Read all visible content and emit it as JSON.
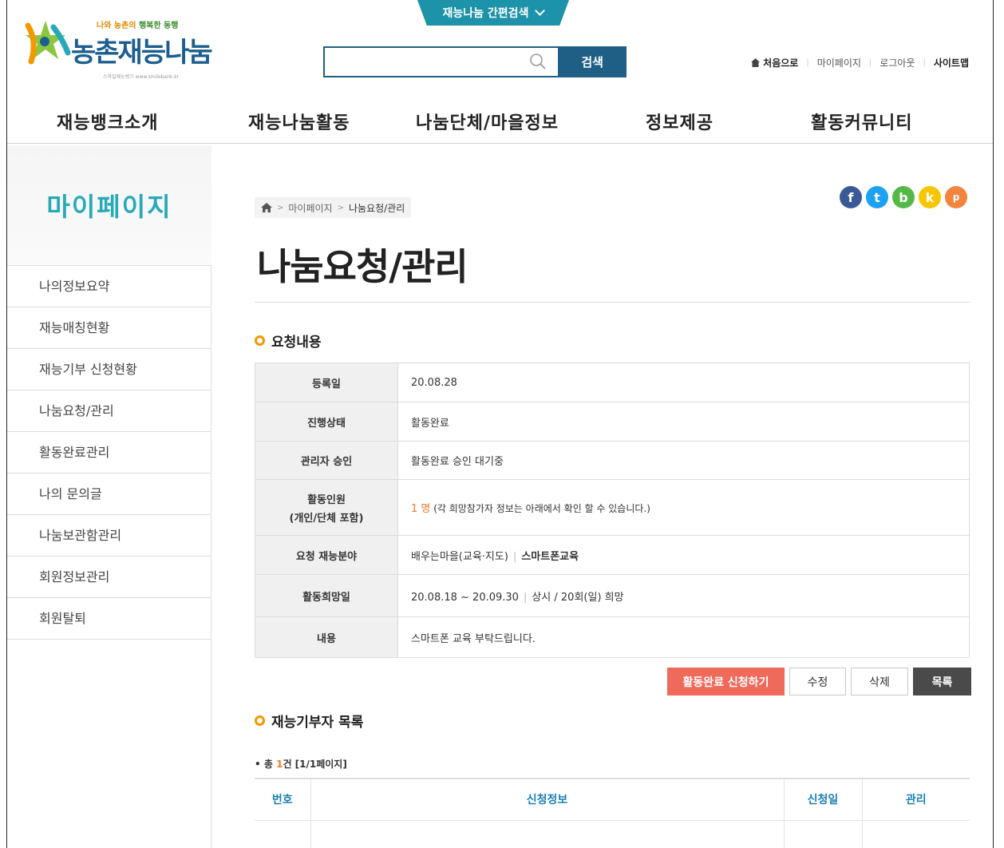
{
  "header": {
    "quick_search_tab": "재능나눔 간편검색",
    "logo": {
      "slogan_pre": "나와 농촌의",
      "slogan_mid": " 행복한 동행",
      "name": "농촌재능나눔",
      "site": "스마일재능뱅크  www.smilebank.kr"
    },
    "search": {
      "placeholder": "",
      "button": "검색"
    },
    "util": {
      "home": "처음으로",
      "mypage": "마이페이지",
      "logout": "로그아웃",
      "sitemap": "사이트맵"
    },
    "gnb": [
      "재능뱅크소개",
      "재능나눔활동",
      "나눔단체/마을정보",
      "정보제공",
      "활동커뮤니티"
    ]
  },
  "sidebar": {
    "title": "마이페이지",
    "items": [
      "나의정보요약",
      "재능매칭현황",
      "재능기부 신청현황",
      "나눔요청/관리",
      "활동완료관리",
      "나의 문의글",
      "나눔보관함관리",
      "회원정보관리",
      "회원탈퇴"
    ]
  },
  "breadcrumb": {
    "sep": ">",
    "level1": "마이페이지",
    "current": "나눔요청/관리"
  },
  "sns": [
    "f",
    "t",
    "b",
    "k",
    "p"
  ],
  "page_title": "나눔요청/관리",
  "request": {
    "section_title": "요청내용",
    "rows": {
      "reg_label": "등록일",
      "reg_value": "20.08.28",
      "status_label": "진행상태",
      "status_value": "활동완료",
      "admin_label": "관리자 승인",
      "admin_value": "활동완료 승인 대기중",
      "members_label_1": "활동인원",
      "members_label_2": "(개인/단체 포함)",
      "members_count": "1 명",
      "members_note": " (각 희망참가자 정보는 아래에서 확인 할 수 있습니다.)",
      "field_label": "요청 재능분야",
      "field_value": "배우는마을(교육·지도)",
      "field_sub": "스마트폰교육",
      "date_label": "활동희망일",
      "date_value": "20.08.18 ~ 20.09.30",
      "date_note": "상시 / 20회(일) 희망",
      "content_label": "내용",
      "content_value": "스마트폰 교육 부탁드립니다."
    }
  },
  "buttons": {
    "complete": "활동완료 신청하기",
    "edit": "수정",
    "delete": "삭제",
    "list": "목록"
  },
  "donors": {
    "section_title": "재능기부자 목록",
    "total_pre": "• 총 ",
    "total_count": "1",
    "total_post": "건 [1/1페이지]",
    "headers": [
      "번호",
      "신청정보",
      "신청일",
      "관리"
    ]
  },
  "colors": {
    "accent": "#27a9b8",
    "nav_dark": "#1f5f85",
    "orange": "#f07a28",
    "btn_red": "#ef6a5a"
  }
}
